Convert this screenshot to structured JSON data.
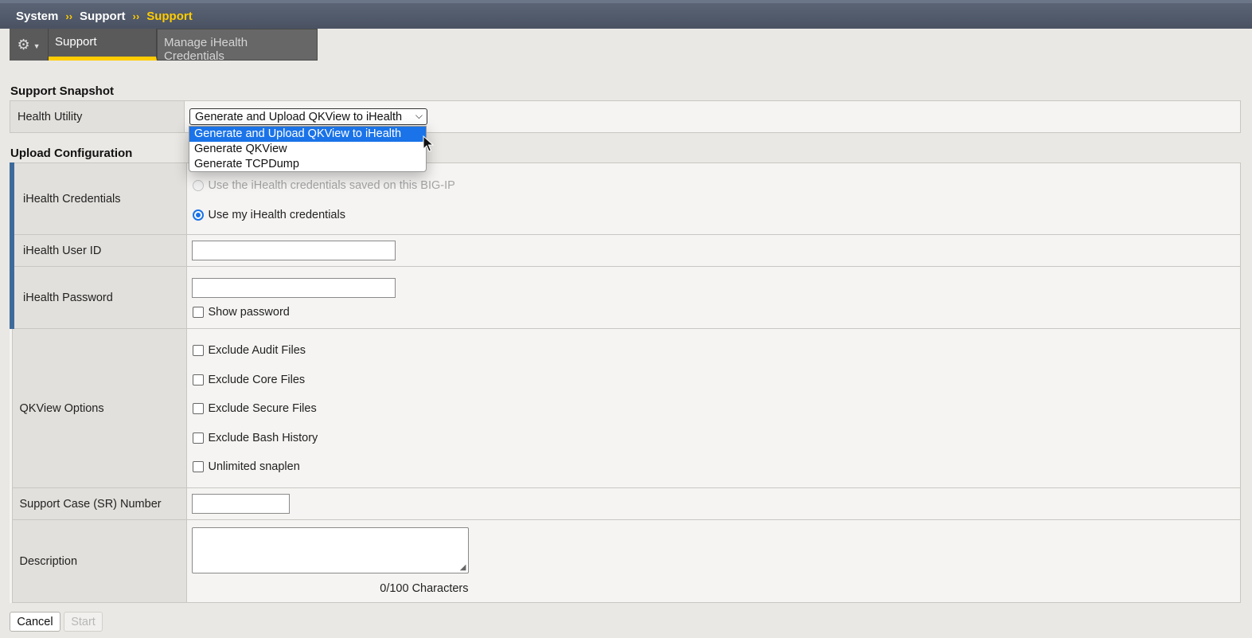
{
  "breadcrumb": {
    "items": [
      "System",
      "Support"
    ],
    "current": "Support",
    "separator": "››"
  },
  "tabs": {
    "settings_icon": "gear-icon",
    "items": [
      {
        "label": "Support",
        "active": true
      },
      {
        "label": "Manage iHealth Credentials",
        "active": false
      }
    ]
  },
  "support_snapshot": {
    "title": "Support Snapshot",
    "health_utility_label": "Health Utility",
    "health_utility_value": "Generate and Upload QKView to iHealth",
    "options": [
      "Generate and Upload QKView to iHealth",
      "Generate QKView",
      "Generate TCPDump"
    ]
  },
  "upload_config": {
    "title": "Upload Configuration",
    "credentials_label": "iHealth Credentials",
    "credential_options": [
      {
        "label": "Use the iHealth credentials saved on this BIG-IP",
        "checked": false,
        "disabled": true
      },
      {
        "label": "Use my iHealth credentials",
        "checked": true,
        "disabled": false
      }
    ],
    "user_id_label": "iHealth User ID",
    "user_id_value": "",
    "password_label": "iHealth Password",
    "password_value": "",
    "show_password_label": "Show password",
    "qkview_options_label": "QKView Options",
    "qkview_options": [
      "Exclude Audit Files",
      "Exclude Core Files",
      "Exclude Secure Files",
      "Exclude Bash History",
      "Unlimited snaplen"
    ],
    "case_number_label": "Support Case (SR) Number",
    "case_number_value": "",
    "description_label": "Description",
    "description_value": "",
    "char_count": "0/100 Characters"
  },
  "actions": {
    "cancel_label": "Cancel",
    "start_label": "Start"
  },
  "colors": {
    "accent_yellow": "#ffcc00",
    "required_bar": "#3e6a9b",
    "dropdown_highlight": "#1a73e8"
  }
}
